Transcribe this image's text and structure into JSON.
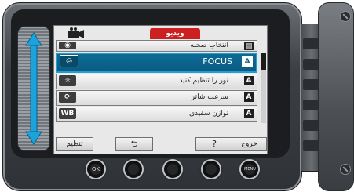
{
  "menu": {
    "tab_label": "ویدیو",
    "rows": [
      {
        "label": "انتخاب صحنه",
        "icon": "scene-icon",
        "tag": "▤",
        "partial": true
      },
      {
        "label": "FOCUS",
        "icon": "focus-icon",
        "tag": "A",
        "selected": true
      },
      {
        "label": "نور را تنظیم کنید",
        "icon": "brightness-icon",
        "tag": "A"
      },
      {
        "label": "سرعت شاتر",
        "icon": "shutter-icon",
        "tag": "A"
      },
      {
        "label": "توازن سفیدی",
        "icon": "wb-icon",
        "tag": "A"
      }
    ]
  },
  "softkeys": {
    "settings": "تنظیم",
    "back": "⮌",
    "help": "?",
    "exit": "خروج"
  },
  "hardware": {
    "ok": "OK",
    "menu": "MENU"
  },
  "colors": {
    "accent_tab": "#cc1f1f",
    "selection": "#0c5b82"
  }
}
